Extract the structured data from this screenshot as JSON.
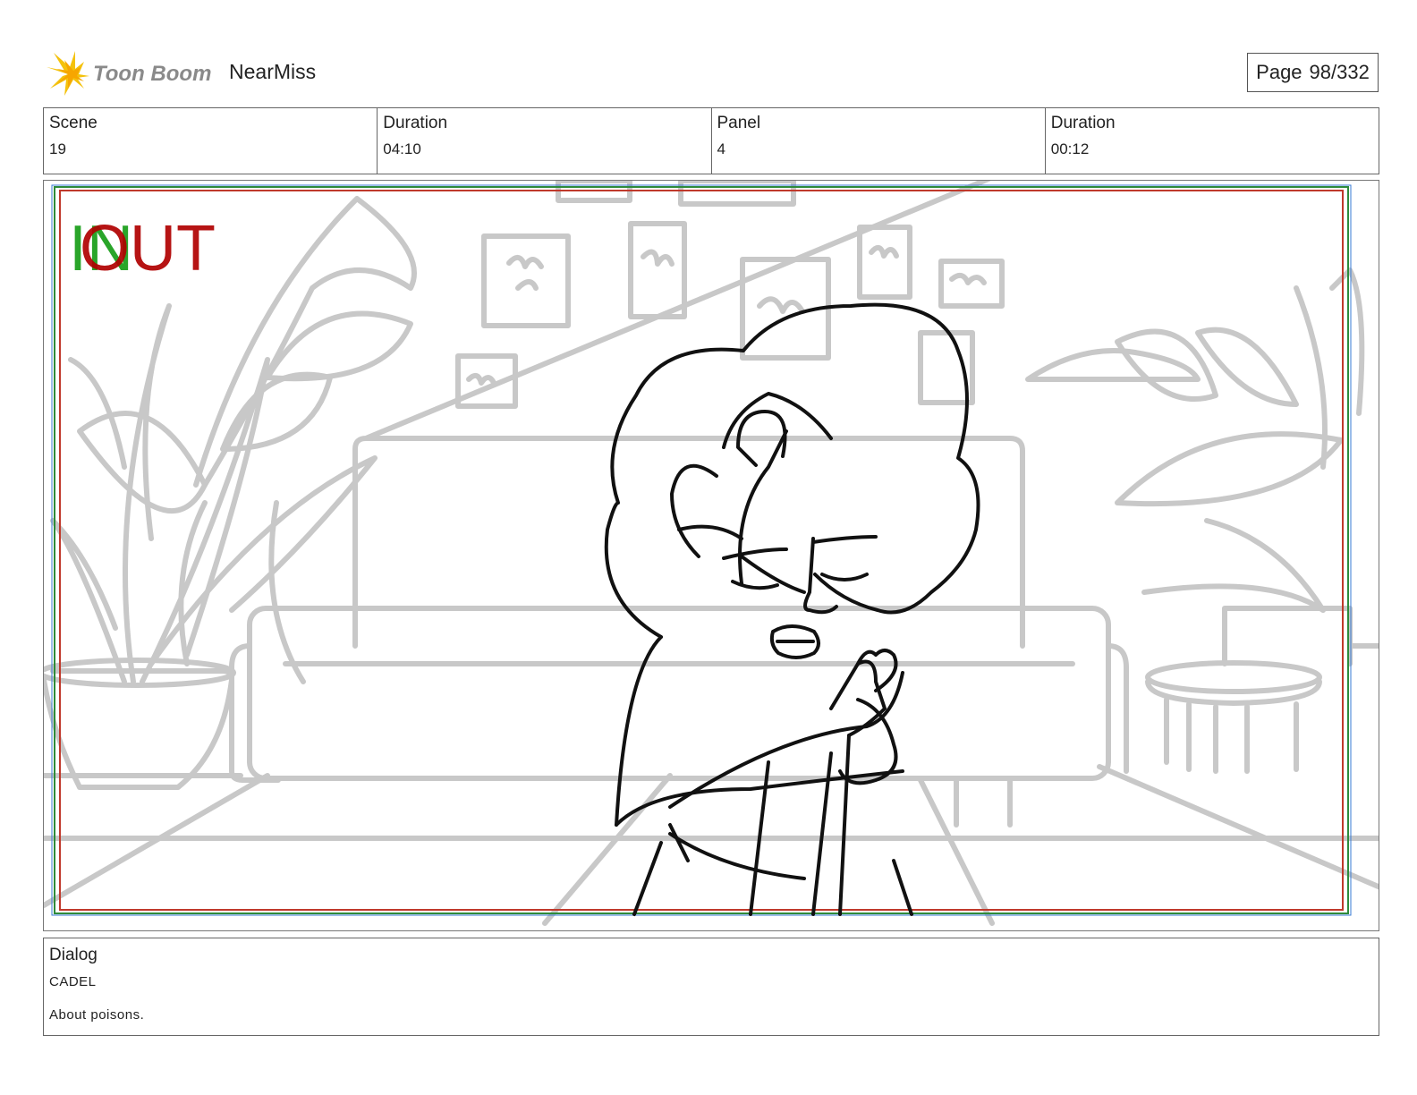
{
  "header": {
    "logo_text": "Toon Boom",
    "project_title": "NearMiss",
    "page_label": "Page",
    "page_number": "98/332"
  },
  "info": {
    "scene_label": "Scene",
    "scene_value": "19",
    "scene_duration_label": "Duration",
    "scene_duration_value": "04:10",
    "panel_label": "Panel",
    "panel_value": "4",
    "panel_duration_label": "Duration",
    "panel_duration_value": "00:12"
  },
  "panel_image": {
    "in_marker": "IN",
    "out_marker": "OUT",
    "in_color": "#2aa52a",
    "out_color": "#b00000",
    "frame_colors": [
      "#2e8b3a",
      "#c0392b",
      "#3a7bd5"
    ],
    "sketch_color": "#c8c8c8",
    "ink_color": "#111111"
  },
  "dialog": {
    "label": "Dialog",
    "speaker": "CADEL",
    "line": "About poisons."
  }
}
